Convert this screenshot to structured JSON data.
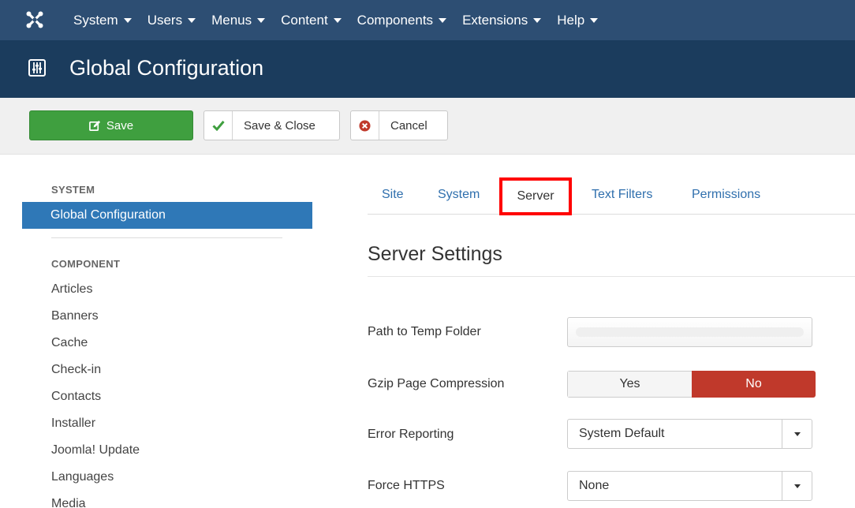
{
  "colors": {
    "topbar": "#2d4e73",
    "header": "#1b3c5d",
    "save_green": "#3f9f3f",
    "sidebar_active": "#2f78b7",
    "link_blue": "#2f6fad",
    "toggle_no_red": "#c0392b",
    "highlight_box": "#ff0000"
  },
  "topnav": {
    "logo_icon": "joomla-logo-icon",
    "menus": [
      {
        "label": "System"
      },
      {
        "label": "Users"
      },
      {
        "label": "Menus"
      },
      {
        "label": "Content"
      },
      {
        "label": "Components"
      },
      {
        "label": "Extensions"
      },
      {
        "label": "Help"
      }
    ]
  },
  "header": {
    "icon": "sliders-icon",
    "title": "Global Configuration"
  },
  "toolbar": {
    "save_label": "Save",
    "save_close_label": "Save & Close",
    "cancel_label": "Cancel"
  },
  "sidebar": {
    "system_heading": "SYSTEM",
    "active_item": "Global Configuration",
    "component_heading": "COMPONENT",
    "items": [
      {
        "label": "Articles"
      },
      {
        "label": "Banners"
      },
      {
        "label": "Cache"
      },
      {
        "label": "Check-in"
      },
      {
        "label": "Contacts"
      },
      {
        "label": "Installer"
      },
      {
        "label": "Joomla! Update"
      },
      {
        "label": "Languages"
      },
      {
        "label": "Media"
      }
    ]
  },
  "tabs": {
    "site": "Site",
    "system": "System",
    "server": "Server",
    "text_filters": "Text Filters",
    "permissions": "Permissions",
    "active": "Server"
  },
  "settings": {
    "title": "Server Settings",
    "temp_folder": {
      "label": "Path to Temp Folder",
      "value": ""
    },
    "gzip": {
      "label": "Gzip Page Compression",
      "yes": "Yes",
      "no": "No",
      "selected": "No"
    },
    "error_reporting": {
      "label": "Error Reporting",
      "value": "System Default"
    },
    "force_https": {
      "label": "Force HTTPS",
      "value": "None"
    }
  }
}
